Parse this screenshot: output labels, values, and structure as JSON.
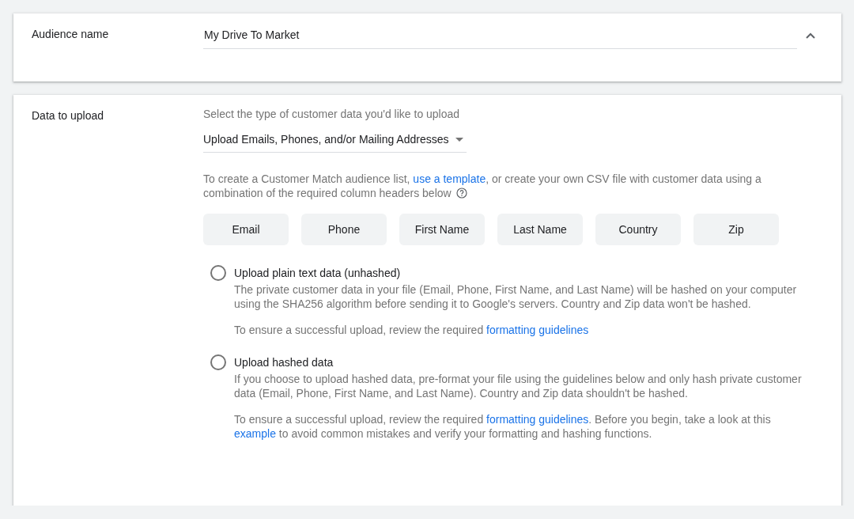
{
  "audience": {
    "label": "Audience name",
    "value": "My Drive To Market",
    "expanded": true
  },
  "upload": {
    "label": "Data to upload",
    "prompt": "Select the type of customer data you'd like to upload",
    "dropdown": "Upload Emails, Phones, and/or Mailing Addresses",
    "intro": [
      {
        "text": "To create a Customer Match audience list, "
      },
      {
        "text": "use a template",
        "link": true
      },
      {
        "text": ", or create your own CSV file with customer data using a combination of the required column headers below"
      }
    ],
    "columns": [
      "Email",
      "Phone",
      "First Name",
      "Last Name",
      "Country",
      "Zip"
    ],
    "options": [
      {
        "label": "Upload plain text data (unhashed)",
        "selected": false,
        "description": "The private customer data in your file (Email, Phone, First Name, and Last Name) will be hashed on your computer using the SHA256 algorithm before sending it to Google's servers. Country and Zip data won't be hashed.",
        "note": [
          {
            "text": "To ensure a successful upload, review the required "
          },
          {
            "text": "formatting guidelines",
            "link": true
          }
        ]
      },
      {
        "label": "Upload hashed data",
        "selected": false,
        "description": "If you choose to upload hashed data, pre-format your file using the guidelines below and only hash private customer data (Email, Phone, First Name, and Last Name). Country and Zip data shouldn't be hashed.",
        "note": [
          {
            "text": "To ensure a successful upload, review the required "
          },
          {
            "text": "formatting guidelines",
            "link": true
          },
          {
            "text": ". Before you begin, take a look at this "
          },
          {
            "text": "example",
            "link": true
          },
          {
            "text": " to avoid common mistakes and verify your formatting and hashing functions."
          }
        ]
      }
    ]
  }
}
